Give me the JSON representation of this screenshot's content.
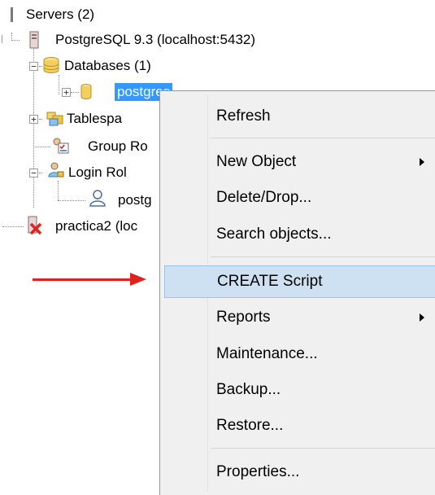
{
  "tree": {
    "servers": "Servers (2)",
    "server1": "PostgreSQL 9.3 (localhost:5432)",
    "databases": "Databases (1)",
    "db_postgres": "postgres",
    "tablespaces": "Tablespa",
    "group_roles": "Group Ro",
    "login_roles": "Login Rol",
    "login_postgres": "postg",
    "server2": "practica2 (loc"
  },
  "context_menu": {
    "items": [
      {
        "label": "Refresh"
      },
      {
        "label": "New Object"
      },
      {
        "label": "Delete/Drop..."
      },
      {
        "label": "Search objects..."
      },
      {
        "label": "CREATE Script"
      },
      {
        "label": "Reports"
      },
      {
        "label": "Maintenance..."
      },
      {
        "label": "Backup..."
      },
      {
        "label": "Restore..."
      },
      {
        "label": "Properties..."
      }
    ]
  },
  "colors": {
    "selection": "#3399ff",
    "menu_hover": "#cde1f3",
    "arrow": "#e2211c"
  }
}
